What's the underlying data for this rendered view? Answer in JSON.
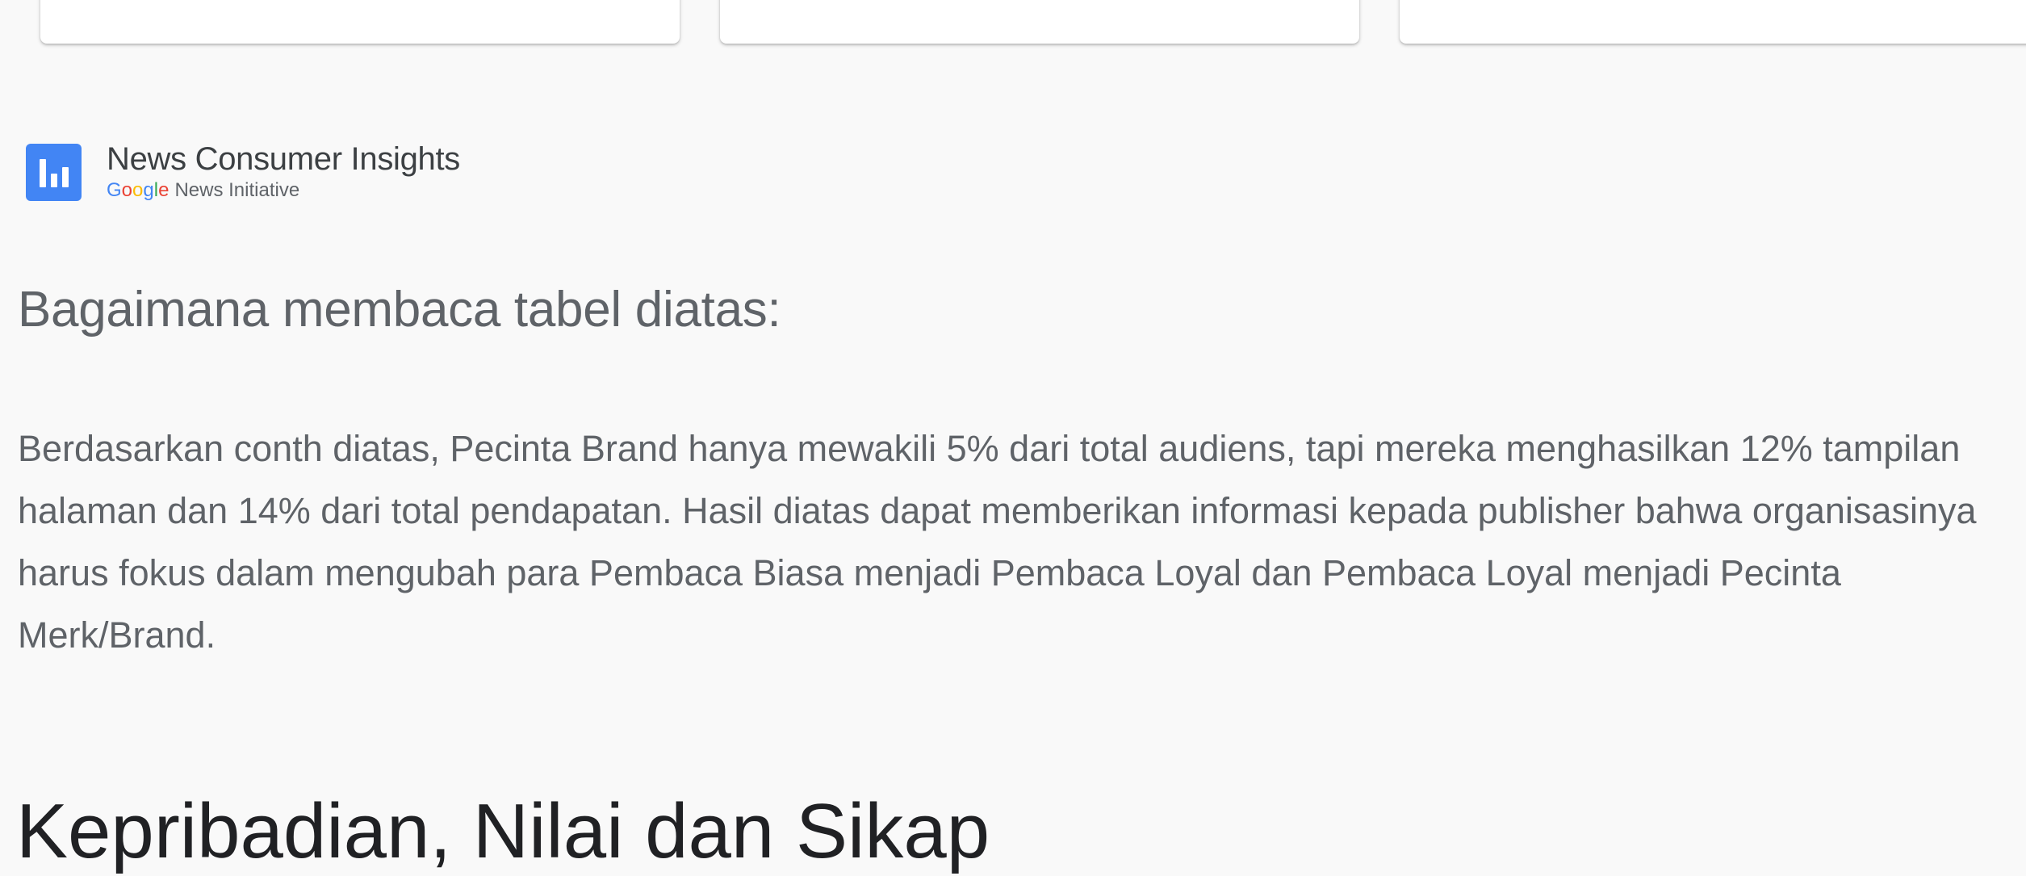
{
  "brand": {
    "title": "News Consumer Insights",
    "google_letters": [
      "G",
      "o",
      "o",
      "g",
      "l",
      "e"
    ],
    "subtitle": "News Initiative",
    "logo_icon": "bar-chart-icon",
    "logo_color": "#4285f4"
  },
  "section": {
    "heading": "Bagaimana membaca tabel diatas:",
    "body": "Berdasarkan conth diatas, Pecinta Brand hanya mewakili 5% dari total audiens, tapi mereka menghasilkan 12% tampilan halaman dan 14% dari total pendapatan. Hasil diatas dapat memberikan informasi kepada publisher bahwa organisasinya harus fokus dalam mengubah para Pembaca Biasa menjadi Pembaca Loyal dan Pembaca Loyal menjadi Pecinta Merk/Brand."
  },
  "next_section": {
    "heading": "Kepribadian, Nilai dan Sikap"
  },
  "colors": {
    "background": "#f9f9f9",
    "card": "#ffffff",
    "text": "#5f6368",
    "heading_dark": "#202124",
    "google_blue": "#4285f4",
    "google_red": "#ea4335",
    "google_yellow": "#fbbc05",
    "google_green": "#34a853"
  }
}
